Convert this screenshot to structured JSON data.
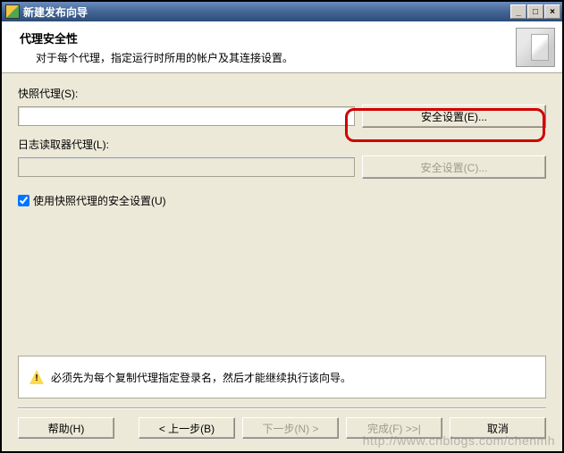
{
  "titlebar": {
    "title": "新建发布向导"
  },
  "banner": {
    "title": "代理安全性",
    "subtitle": "对于每个代理，指定运行时所用的帐户及其连接设置。"
  },
  "snapshot": {
    "label": "快照代理(S):",
    "value": "",
    "button": "安全设置(E)..."
  },
  "logreader": {
    "label": "日志读取器代理(L):",
    "value": "",
    "button": "安全设置(C)..."
  },
  "checkbox": {
    "label": "使用快照代理的安全设置(U)",
    "checked": true
  },
  "warning": {
    "text": "必须先为每个复制代理指定登录名，然后才能继续执行该向导。"
  },
  "footer": {
    "help": "帮助(H)",
    "back": "< 上一步(B)",
    "next": "下一步(N) >",
    "finish": "完成(F) >>|",
    "cancel": "取消"
  },
  "watermark": "http://www.cnblogs.com/chenmh"
}
